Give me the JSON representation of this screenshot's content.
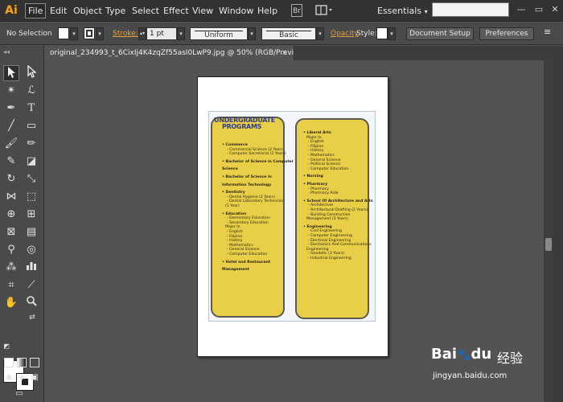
{
  "app": {
    "logo": "Ai",
    "menus": [
      "File",
      "Edit",
      "Object",
      "Type",
      "Select",
      "Effect",
      "View",
      "Window",
      "Help"
    ],
    "workspace": "Essentials",
    "workspace_arrow": "▾"
  },
  "control_bar": {
    "selection_status": "No Selection",
    "stroke_label": "Stroke:",
    "stroke_weight": "1 pt",
    "variable_width": "Uniform",
    "brush": "Basic",
    "opacity_label": "Opacity",
    "style_label": "Style:",
    "document_setup": "Document Setup",
    "preferences": "Preferences"
  },
  "document": {
    "tab_title": "original_234993_t_6CixIj4K4zqZf55asI0LwP9.jpg @ 50% (RGB/Preview)",
    "tab_close": "×"
  },
  "toolbox": {
    "tools": [
      "selection-tool",
      "direct-selection-tool",
      "magic-wand-tool",
      "lasso-tool",
      "pen-tool",
      "type-tool",
      "line-segment-tool",
      "rectangle-tool",
      "paintbrush-tool",
      "pencil-tool",
      "blob-brush-tool",
      "eraser-tool",
      "rotate-tool",
      "scale-tool",
      "width-tool",
      "free-transform-tool",
      "shape-builder-tool",
      "perspective-grid-tool",
      "mesh-tool",
      "gradient-tool",
      "eyedropper-tool",
      "blend-tool",
      "symbol-sprayer-tool",
      "column-graph-tool",
      "artboard-tool",
      "slice-tool",
      "hand-tool",
      "zoom-tool"
    ]
  },
  "artwork": {
    "left_panel": {
      "title_line1": "UNDERGRADUATE",
      "title_line2": "PROGRAMS",
      "lines": [
        {
          "text": "• Commerce",
          "head": true
        },
        {
          "text": "- Commercial Science (2 Years",
          "head": false
        },
        {
          "text": "- Computer Secretarial (2 Years)",
          "head": false
        },
        {
          "text": "• Bachelor of Science in Computer",
          "head": true
        },
        {
          "text": "Science",
          "head": true
        },
        {
          "text": "• Bachelor of Science in",
          "head": true
        },
        {
          "text": "Information Technology",
          "head": true
        },
        {
          "text": "• Dentistry",
          "head": true
        },
        {
          "text": "- Dental Hygiene (2 Years)",
          "head": false
        },
        {
          "text": "- Dental Laboratory Technician",
          "head": false
        },
        {
          "text": "(1 Year)",
          "head": false
        },
        {
          "text": "• Education",
          "head": true
        },
        {
          "text": "- Elementary Education",
          "head": false
        },
        {
          "text": "- Secondary Education",
          "head": false
        },
        {
          "text": "Major In",
          "head": false
        },
        {
          "text": "- English",
          "head": false
        },
        {
          "text": "- Filipino",
          "head": false
        },
        {
          "text": "- History",
          "head": false
        },
        {
          "text": "- Mathematics",
          "head": false
        },
        {
          "text": "- General Science",
          "head": false
        },
        {
          "text": "- Computer Education",
          "head": false
        },
        {
          "text": "• Hotel and Restaurant",
          "head": true
        },
        {
          "text": "Management",
          "head": true
        }
      ]
    },
    "right_panel": {
      "lines": [
        {
          "text": "• Liberal Arts",
          "head": true
        },
        {
          "text": "Major In",
          "head": false
        },
        {
          "text": "- English",
          "head": false
        },
        {
          "text": "- Filipino",
          "head": false
        },
        {
          "text": "- History",
          "head": false
        },
        {
          "text": "- Mathematics",
          "head": false
        },
        {
          "text": "- General Science",
          "head": false
        },
        {
          "text": "- Political Science",
          "head": false
        },
        {
          "text": "- Computer Education",
          "head": false
        },
        {
          "text": "• Nursing",
          "head": true
        },
        {
          "text": "• Pharmacy",
          "head": true
        },
        {
          "text": "- Pharmacy",
          "head": false
        },
        {
          "text": "- Pharmacy Aide",
          "head": false
        },
        {
          "text": "• School Of Architecture and Arts",
          "head": true
        },
        {
          "text": "- Architecture",
          "head": false
        },
        {
          "text": "- Architectural Drafting (2 Years)",
          "head": false
        },
        {
          "text": "- Building Construction",
          "head": false
        },
        {
          "text": "Management (3 Years)",
          "head": false
        },
        {
          "text": "• Engineering",
          "head": true
        },
        {
          "text": "- Civil Engineering",
          "head": false
        },
        {
          "text": "- Computer Engineering",
          "head": false
        },
        {
          "text": "- Electrical Engineering",
          "head": false
        },
        {
          "text": "- Electronics And Communications",
          "head": false
        },
        {
          "text": "Engineering",
          "head": false
        },
        {
          "text": "- Geodetic (3 Years)",
          "head": false
        },
        {
          "text": "- Industrial Engineering",
          "head": false
        }
      ]
    }
  },
  "watermark": {
    "brand": "Bai",
    "brand_suffix": "du",
    "product": "经验",
    "url": "jingyan.baidu.com"
  },
  "colors": {
    "accent": "#f9a21b",
    "panel_yellow": "#e8cf47",
    "title_blue": "#2f3d8c"
  }
}
